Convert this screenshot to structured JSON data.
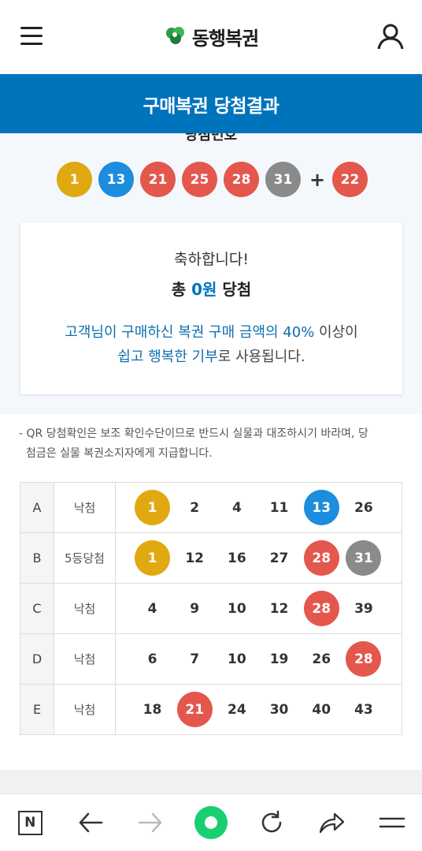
{
  "header": {
    "logo_text": "동행복권",
    "menu_icon": "hamburger-menu-icon",
    "user_icon": "user-icon"
  },
  "title_bar": {
    "title": "구매복권 당첨결과",
    "color": "#0073bd"
  },
  "winning": {
    "label": "당첨번호",
    "numbers": [
      {
        "n": "1",
        "color": "#e0a912"
      },
      {
        "n": "13",
        "color": "#1d8ddd"
      },
      {
        "n": "21",
        "color": "#e4574d"
      },
      {
        "n": "25",
        "color": "#e4574d"
      },
      {
        "n": "28",
        "color": "#e4574d"
      },
      {
        "n": "31",
        "color": "#8a8a8a"
      }
    ],
    "plus": "+",
    "bonus": {
      "n": "22",
      "color": "#e4574d"
    }
  },
  "result_card": {
    "congrats": "축하합니다!",
    "total_prefix": "총 ",
    "total_amount": "0원",
    "total_suffix": " 당첨",
    "donate_line1_blue": "고객님이 구매하신 복권 구매 금액의 40%",
    "donate_line1_rest": " 이상이",
    "donate_line2_blue": "쉽고 행복한 기부",
    "donate_line2_rest": "로 사용됩니다."
  },
  "notice": {
    "line1": "- QR 당첨확인은 보조 확인수단이므로 반드시 실물과 대조하시기 바라며, 당",
    "line2": "첨금은 실물 복권소지자에게 지급합니다."
  },
  "games": [
    {
      "key": "A",
      "result": "낙첨",
      "numbers": [
        {
          "n": "1",
          "color": "#e0a912"
        },
        {
          "n": "2"
        },
        {
          "n": "4"
        },
        {
          "n": "11"
        },
        {
          "n": "13",
          "color": "#1d8ddd"
        },
        {
          "n": "26"
        }
      ]
    },
    {
      "key": "B",
      "result": "5등당첨",
      "numbers": [
        {
          "n": "1",
          "color": "#e0a912"
        },
        {
          "n": "12"
        },
        {
          "n": "16"
        },
        {
          "n": "27"
        },
        {
          "n": "28",
          "color": "#e4574d"
        },
        {
          "n": "31",
          "color": "#8a8a8a"
        }
      ]
    },
    {
      "key": "C",
      "result": "낙첨",
      "numbers": [
        {
          "n": "4"
        },
        {
          "n": "9"
        },
        {
          "n": "10"
        },
        {
          "n": "12"
        },
        {
          "n": "28",
          "color": "#e4574d"
        },
        {
          "n": "39"
        }
      ]
    },
    {
      "key": "D",
      "result": "낙첨",
      "numbers": [
        {
          "n": "6"
        },
        {
          "n": "7"
        },
        {
          "n": "10"
        },
        {
          "n": "19"
        },
        {
          "n": "26"
        },
        {
          "n": "28",
          "color": "#e4574d"
        }
      ]
    },
    {
      "key": "E",
      "result": "낙첨",
      "numbers": [
        {
          "n": "18"
        },
        {
          "n": "21",
          "color": "#e4574d"
        },
        {
          "n": "24"
        },
        {
          "n": "30"
        },
        {
          "n": "40"
        },
        {
          "n": "43"
        }
      ]
    }
  ],
  "bottom_nav": {
    "items": [
      "n-logo-icon",
      "back-arrow-icon",
      "forward-arrow-icon",
      "home-icon",
      "refresh-icon",
      "share-icon",
      "menu-icon"
    ],
    "n_label": "N",
    "home_color": "#19cf72"
  }
}
